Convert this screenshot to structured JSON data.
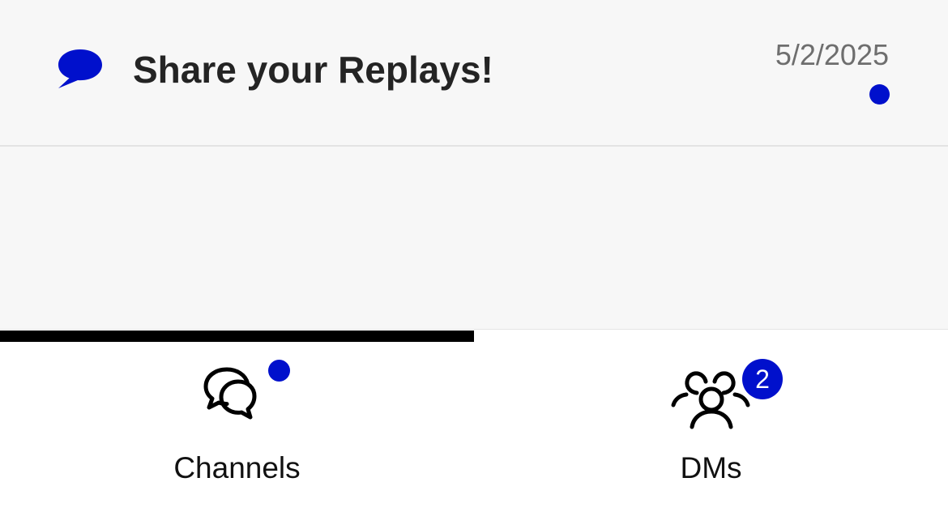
{
  "colors": {
    "accent": "#0010cc",
    "text_primary": "#242424",
    "text_secondary": "#6e6e6e",
    "background": "#f7f7f7",
    "tab_bar_background": "#ffffff"
  },
  "channels": [
    {
      "name": "Share your Replays!",
      "date": "5/2/2025",
      "icon": "chat-bubble-icon",
      "unread": true
    }
  ],
  "tabs": [
    {
      "label": "Channels",
      "icon": "chat-bubbles-icon",
      "active": true,
      "unread_dot": true
    },
    {
      "label": "DMs",
      "icon": "people-group-icon",
      "active": false,
      "badge": "2"
    }
  ]
}
